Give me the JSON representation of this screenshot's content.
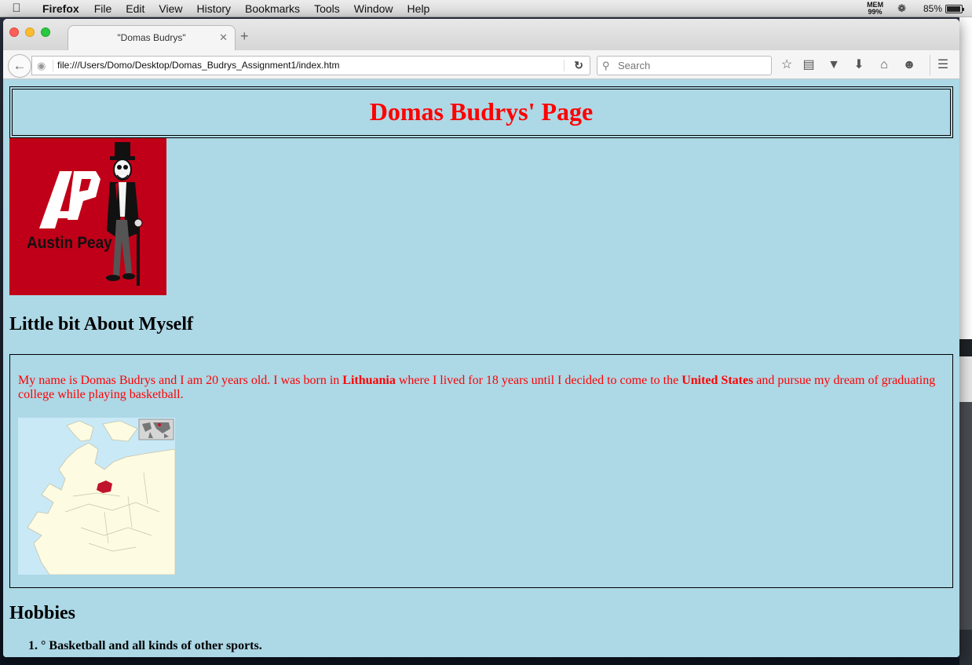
{
  "menubar": {
    "app_name": "Firefox",
    "items": [
      "File",
      "Edit",
      "View",
      "History",
      "Bookmarks",
      "Tools",
      "Window",
      "Help"
    ],
    "mem_label": "MEM",
    "mem_value": "99%",
    "battery_percent": "85%",
    "battery_level": 0.85
  },
  "browser": {
    "tab_title": "\"Domas Budrys\"",
    "url": "file:///Users/Domo/Desktop/Domas_Budrys_Assignment1/index.htm",
    "search_placeholder": "Search",
    "toolbar_icons": [
      "bookmark-star-icon",
      "reading-list-icon",
      "pocket-icon",
      "download-icon",
      "home-icon",
      "hello-icon",
      "menu-icon"
    ]
  },
  "page": {
    "title": "Domas Budrys' Page",
    "logo_text": "Austin Peay",
    "about_heading": "Little bit About Myself",
    "about_text_1": "My name is Domas Budrys and I am 20 years old. I was born in ",
    "about_bold_1": "Lithuania",
    "about_text_2": " where I lived for 18 years until I decided to come to the ",
    "about_bold_2": "United States",
    "about_text_3": " and pursue my dream of graduating college while playing basketball.",
    "hobbies_heading": "Hobbies",
    "hobbies": [
      "° Basketball and all kinds of other sports."
    ]
  },
  "colors": {
    "page_background": "#add8e6",
    "title_color": "#ff0000",
    "logo_red": "#c00018"
  }
}
